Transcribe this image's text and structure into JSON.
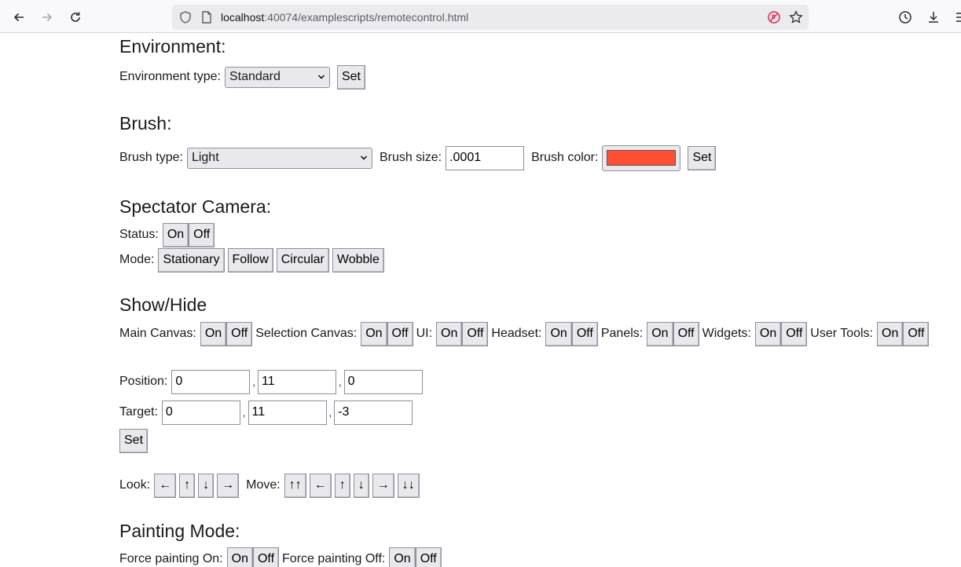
{
  "browser": {
    "url_host": "localhost",
    "url_rest": ":40074/examplescripts/remotecontrol.html"
  },
  "environment": {
    "heading": "Environment:",
    "type_label": "Environment type:",
    "type_value": "Standard",
    "set_label": "Set"
  },
  "brush": {
    "heading": "Brush:",
    "type_label": "Brush type:",
    "type_value": "Light",
    "size_label": "Brush size:",
    "size_value": ".0001",
    "color_label": "Brush color:",
    "color_value": "#ff4f33",
    "set_label": "Set"
  },
  "spectator": {
    "heading": "Spectator Camera:",
    "status_label": "Status:",
    "status_on": "On",
    "status_off": "Off",
    "mode_label": "Mode:",
    "modes": [
      "Stationary",
      "Follow",
      "Circular",
      "Wobble"
    ]
  },
  "showhide": {
    "heading": "Show/Hide",
    "items": [
      {
        "label": "Main Canvas:",
        "on": "On",
        "off": "Off"
      },
      {
        "label": "Selection Canvas:",
        "on": "On",
        "off": "Off"
      },
      {
        "label": "UI:",
        "on": "On",
        "off": "Off"
      },
      {
        "label": "Headset:",
        "on": "On",
        "off": "Off"
      },
      {
        "label": "Panels:",
        "on": "On",
        "off": "Off"
      },
      {
        "label": "Widgets:",
        "on": "On",
        "off": "Off"
      },
      {
        "label": "User Tools:",
        "on": "On",
        "off": "Off"
      }
    ]
  },
  "transform": {
    "position_label": "Position:",
    "position": [
      "0",
      "11",
      "0"
    ],
    "target_label": "Target:",
    "target": [
      "0",
      "11",
      "-3"
    ],
    "comma": ",",
    "set_label": "Set"
  },
  "look_move": {
    "look_label": "Look:",
    "look": [
      "←",
      "↑",
      "↓",
      "→"
    ],
    "move_label": "Move:",
    "move": [
      "↑↑",
      "←",
      "↑",
      "↓",
      "→",
      "↓↓"
    ]
  },
  "painting": {
    "heading": "Painting Mode:",
    "force_on_label": "Force painting On:",
    "force_off_label": "Force painting Off:",
    "on": "On",
    "off": "Off"
  }
}
